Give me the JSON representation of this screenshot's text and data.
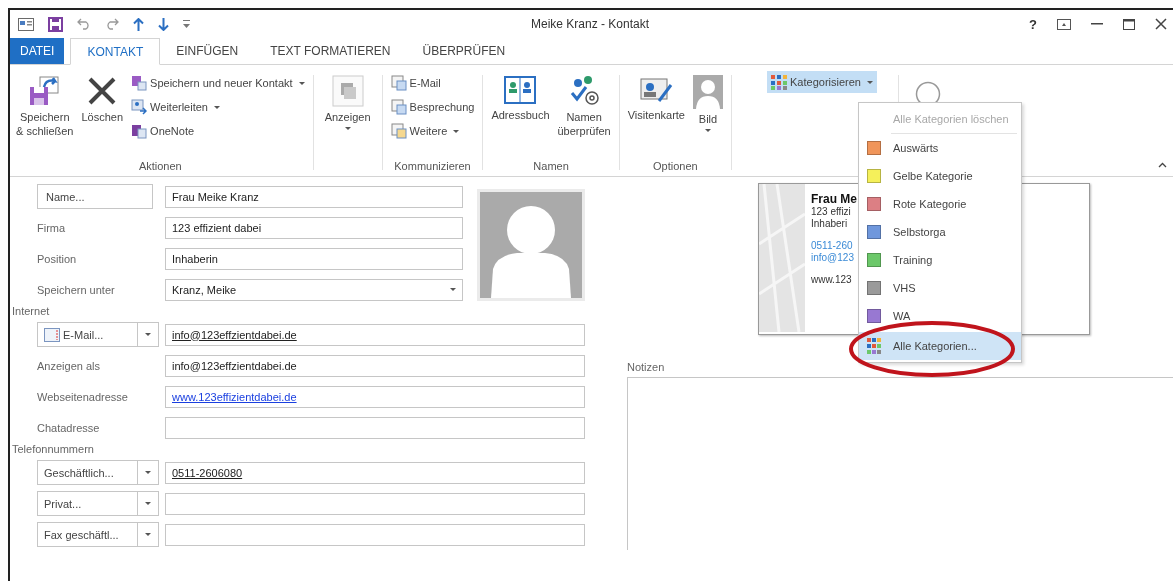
{
  "window": {
    "title": "Meike Kranz - Kontakt",
    "help": "?"
  },
  "tabs": [
    {
      "label": "DATEI",
      "kind": "file",
      "selected": false
    },
    {
      "label": "KONTAKT",
      "kind": "tab",
      "selected": true
    },
    {
      "label": "EINFÜGEN",
      "kind": "tab",
      "selected": false
    },
    {
      "label": "TEXT FORMATIEREN",
      "kind": "tab",
      "selected": false
    },
    {
      "label": "ÜBERPRÜFEN",
      "kind": "tab",
      "selected": false
    }
  ],
  "ribbon": {
    "groups": [
      {
        "kind": "actions",
        "label": "Aktionen",
        "buttons": [
          {
            "label": "Speichern\n& schließen"
          },
          {
            "label": "Löschen"
          },
          {
            "label": "Speichern und neuer Kontakt",
            "dropdown": true
          },
          {
            "label": "Weiterleiten",
            "dropdown": true
          },
          {
            "label": "OneNote",
            "dropdown": false
          }
        ]
      },
      {
        "kind": "show",
        "buttons": [
          {
            "label": "Anzeigen",
            "dropdown": true
          }
        ]
      },
      {
        "kind": "communicate",
        "label": "Kommunizieren",
        "buttons": [
          {
            "label": "E-Mail",
            "dropdown": false
          },
          {
            "label": "Besprechung",
            "dropdown": false
          },
          {
            "label": "Weitere",
            "dropdown": true
          }
        ]
      },
      {
        "kind": "names",
        "label": "Namen",
        "buttons": [
          {
            "label": "Adressbuch"
          },
          {
            "label": "Namen\nüberprüfen"
          }
        ]
      },
      {
        "kind": "options",
        "label": "Optionen",
        "buttons": [
          {
            "label": "Visitenkarte",
            "dropdown": false
          },
          {
            "label": "Bild",
            "dropdown": true
          }
        ]
      },
      {
        "kind": "tags",
        "buttons": [
          {
            "label": "Kategorisieren",
            "dropdown": true,
            "selected": true
          }
        ]
      },
      {
        "kind": "zoom"
      }
    ]
  },
  "category_menu": {
    "items": [
      {
        "kind": "action",
        "label": "Alle Kategorien löschen",
        "disabled": true,
        "selected": false
      },
      {
        "kind": "category",
        "label": "Auswärts",
        "color": "#f0955a",
        "selected": false
      },
      {
        "kind": "category",
        "label": "Gelbe Kategorie",
        "color": "#f5f05a",
        "selected": false
      },
      {
        "kind": "category",
        "label": "Rote Kategorie",
        "color": "#dc7f84",
        "selected": false
      },
      {
        "kind": "category",
        "label": "Selbstorga",
        "color": "#6f97dc",
        "selected": false
      },
      {
        "kind": "category",
        "label": "Training",
        "color": "#6cc86a",
        "selected": false
      },
      {
        "kind": "category",
        "label": "VHS",
        "color": "#9a9a9a",
        "selected": false
      },
      {
        "kind": "category",
        "label": "WA",
        "color": "#9878d2",
        "selected": false
      },
      {
        "kind": "action",
        "label": "Alle Kategorien...",
        "disabled": false,
        "selected": true
      }
    ]
  },
  "form": {
    "top_rows": [
      {
        "kind": "button",
        "label": "Name...",
        "value": "Frau Meike Kranz"
      },
      {
        "kind": "text",
        "label": "Firma",
        "value": "123 effizient dabei"
      },
      {
        "kind": "text",
        "label": "Position",
        "value": "Inhaberin"
      },
      {
        "kind": "select",
        "label": "Speichern unter",
        "value": "Kranz, Meike"
      }
    ],
    "sections": [
      {
        "heading": "Internet",
        "rows": [
          {
            "kind": "split",
            "label": "E-Mail...",
            "value": "info@123effzientdabei.de",
            "underlined": true,
            "link": false,
            "icon": true
          },
          {
            "kind": "text",
            "label": "Anzeigen als",
            "value": "info@123effzientdabei.de",
            "underlined": false,
            "link": false
          },
          {
            "kind": "text",
            "label": "Webseitenadresse",
            "value": "www.123effizientdabei.de",
            "underlined": true,
            "link": true
          },
          {
            "kind": "text",
            "label": "Chatadresse"
          }
        ]
      },
      {
        "heading": "Telefonnummern",
        "rows": [
          {
            "kind": "split",
            "label": "Geschäftlich...",
            "value": "0511-2606080",
            "underlined": true,
            "link": false
          },
          {
            "kind": "split",
            "label": "Privat..."
          },
          {
            "kind": "split",
            "label": "Fax geschäftl..."
          }
        ]
      }
    ]
  },
  "business_card": {
    "name": "Frau Me",
    "lines": [
      "123 effizi",
      "Inhaberi"
    ],
    "contact_lines": [
      "0511-260",
      "info@123"
    ],
    "web": "www.123"
  },
  "notes": {
    "label": "Notizen"
  }
}
